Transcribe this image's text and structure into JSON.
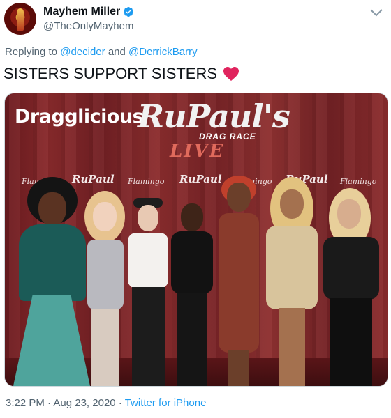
{
  "author": {
    "display_name": "Mayhem Miller",
    "handle": "@TheOnlyMayhem",
    "verified_icon": "verified-badge-icon"
  },
  "reply": {
    "prefix": "Replying to ",
    "mention1": "@decider",
    "and": " and ",
    "mention2": "@DerrickBarry"
  },
  "tweet": {
    "text": "SISTERS SUPPORT SISTERS",
    "emoji_icon": "red-heart-icon"
  },
  "photo": {
    "brand_left": "Dragglicious",
    "brand_main": "RuPaul's",
    "brand_sub": "DRAG RACE",
    "brand_live": "LIVE",
    "sponsor": "Flamingo",
    "repeat_logo": "RuPaul"
  },
  "meta": {
    "time": "3:22 PM",
    "sep1": " · ",
    "date": "Aug 23, 2020",
    "sep2": " · ",
    "source": "Twitter for iPhone"
  },
  "colors": {
    "link": "#1d9bf0",
    "muted": "#536471",
    "heart": "#f91880",
    "backdrop": "#7a2427"
  }
}
